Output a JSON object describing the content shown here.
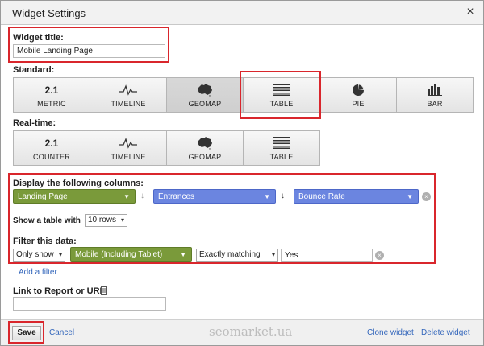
{
  "dialog": {
    "title": "Widget Settings",
    "close_glyph": "×"
  },
  "widget_title": {
    "label": "Widget title:",
    "value": "Mobile Landing Page"
  },
  "standard": {
    "label": "Standard:",
    "buttons": [
      {
        "top": "2.1",
        "label": "METRIC",
        "icon": "metric-icon",
        "active": false
      },
      {
        "label": "TIMELINE",
        "icon": "timeline-icon",
        "active": false
      },
      {
        "label": "GEOMAP",
        "icon": "geomap-icon",
        "active": true
      },
      {
        "label": "TABLE",
        "icon": "table-icon",
        "active": false
      },
      {
        "label": "PIE",
        "icon": "pie-icon",
        "active": false
      },
      {
        "label": "BAR",
        "icon": "bar-icon",
        "active": false
      }
    ]
  },
  "realtime": {
    "label": "Real-time:",
    "buttons": [
      {
        "top": "2.1",
        "label": "COUNTER",
        "icon": "counter-icon"
      },
      {
        "label": "TIMELINE",
        "icon": "timeline-icon"
      },
      {
        "label": "GEOMAP",
        "icon": "geomap-icon"
      },
      {
        "label": "TABLE",
        "icon": "table-icon"
      }
    ]
  },
  "columns": {
    "label": "Display the following columns:",
    "dimension": "Landing Page",
    "metric1": "Entrances",
    "metric2": "Bounce Rate"
  },
  "table_rows": {
    "label": "Show a table with",
    "value": "10 rows"
  },
  "filter": {
    "label": "Filter this data:",
    "mode": "Only show",
    "dimension": "Mobile (Including Tablet)",
    "match": "Exactly matching",
    "value": "Yes",
    "add_filter": "Add a filter"
  },
  "link": {
    "label": "Link to Report or URL:",
    "value": ""
  },
  "footer": {
    "save": "Save",
    "cancel": "Cancel",
    "clone": "Clone widget",
    "delete": "Delete widget"
  },
  "watermark": "seomarket.ua",
  "colors": {
    "highlight": "#d9262c",
    "green_dropdown": "#7a9a3a",
    "blue_dropdown": "#6b85e0",
    "link": "#3366bb"
  }
}
